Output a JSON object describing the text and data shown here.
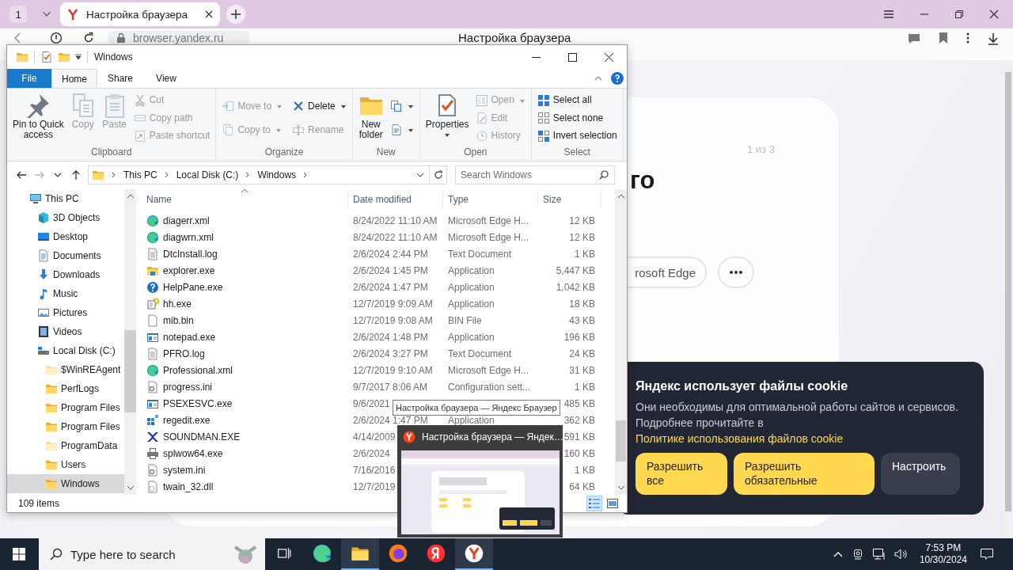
{
  "browser": {
    "tab_counter": "1",
    "tabs": [
      {
        "title": "Настройка браузера",
        "selected": true
      }
    ],
    "address": "browser.yandex.ru",
    "page_title": "Настройка браузера",
    "page": {
      "step": "1 из 3",
      "heading": "го",
      "source_button": "rosoft Edge"
    },
    "cookie_banner": {
      "title": "Яндекс использует файлы cookie",
      "text": "Они необходимы для оптимальной работы сайтов и сервисов. Подробнее прочитайте в ",
      "link": "Политике использования файлов cookie",
      "buttons": [
        {
          "label": "Разрешить все",
          "kind": "primary"
        },
        {
          "label": "Разрешить обязательные",
          "kind": "primary"
        },
        {
          "label": "Настроить",
          "kind": "secondary"
        }
      ]
    }
  },
  "explorer": {
    "title": "Windows",
    "ribbon_tabs": [
      {
        "label": "File",
        "kind": "file",
        "selected": false
      },
      {
        "label": "Home",
        "kind": "tab",
        "selected": true
      },
      {
        "label": "Share",
        "kind": "tab",
        "selected": false
      },
      {
        "label": "View",
        "kind": "tab",
        "selected": false
      }
    ],
    "ribbon_groups": [
      {
        "label": "Clipboard",
        "large": [
          {
            "label": "Pin to Quick\naccess",
            "kind": "pin",
            "disabled": false,
            "menu": false
          },
          {
            "label": "Copy",
            "kind": "copy",
            "disabled": true,
            "menu": false
          },
          {
            "label": "Paste",
            "kind": "paste",
            "disabled": true,
            "menu": false
          }
        ],
        "small": [
          {
            "label": "Cut",
            "kind": "cut",
            "disabled": true,
            "menu": false
          },
          {
            "label": "Copy path",
            "kind": "copy-path",
            "disabled": true,
            "menu": false
          },
          {
            "label": "Paste shortcut",
            "kind": "paste-shortcut",
            "disabled": true,
            "menu": false
          }
        ]
      },
      {
        "label": "Organize",
        "small": [
          {
            "label": "Move to",
            "kind": "move",
            "disabled": true,
            "menu": true
          },
          {
            "label": "Copy to",
            "kind": "copy-to",
            "disabled": true,
            "menu": true
          },
          {
            "label": "Delete",
            "kind": "delete",
            "disabled": false,
            "menu": true
          },
          {
            "label": "Rename",
            "kind": "rename",
            "disabled": true,
            "menu": false
          }
        ]
      },
      {
        "label": "New",
        "large": [
          {
            "label": "New\nfolder",
            "kind": "new-folder",
            "disabled": false,
            "menu": false
          }
        ],
        "small": [
          {
            "kind": "new-item",
            "disabled": false,
            "menu": true
          },
          {
            "kind": "easy-access",
            "disabled": false,
            "menu": true
          }
        ]
      },
      {
        "label": "Open",
        "large": [
          {
            "label": "Properties",
            "kind": "properties",
            "disabled": false,
            "menu": true
          }
        ],
        "small": [
          {
            "label": "Open",
            "kind": "open",
            "disabled": true,
            "menu": true
          },
          {
            "label": "Edit",
            "kind": "edit",
            "disabled": true,
            "menu": false
          },
          {
            "label": "History",
            "kind": "history",
            "disabled": true,
            "menu": false
          }
        ]
      },
      {
        "label": "Select",
        "small": [
          {
            "label": "Select all",
            "kind": "select-all",
            "disabled": false,
            "menu": false
          },
          {
            "label": "Select none",
            "kind": "select-none",
            "disabled": false,
            "menu": false
          },
          {
            "label": "Invert selection",
            "kind": "invert",
            "disabled": false,
            "menu": false
          }
        ]
      }
    ],
    "nav_buttons": [
      {
        "kind": "back",
        "disabled": false
      },
      {
        "kind": "forward",
        "disabled": true
      },
      {
        "kind": "recent",
        "disabled": false
      },
      {
        "kind": "up",
        "disabled": false
      }
    ],
    "breadcrumbs": [
      "This PC",
      "Local Disk (C:)",
      "Windows"
    ],
    "search": {
      "placeholder": "Search Windows"
    },
    "nav": [
      {
        "label": "This PC",
        "kind": "pc",
        "selected": false,
        "children": [
          {
            "label": "3D Objects",
            "kind": "objects3d",
            "selected": false
          },
          {
            "label": "Desktop",
            "kind": "desktop",
            "selected": false
          },
          {
            "label": "Documents",
            "kind": "documents",
            "selected": false
          },
          {
            "label": "Downloads",
            "kind": "downloads",
            "selected": false
          },
          {
            "label": "Music",
            "kind": "music",
            "selected": false
          },
          {
            "label": "Pictures",
            "kind": "pictures",
            "selected": false
          },
          {
            "label": "Videos",
            "kind": "videos",
            "selected": false
          },
          {
            "label": "Local Disk (C:)",
            "kind": "disk",
            "selected": false,
            "children": [
              {
                "label": "$WinREAgent",
                "kind": "hidden-folder",
                "selected": false
              },
              {
                "label": "PerfLogs",
                "kind": "folder",
                "selected": false
              },
              {
                "label": "Program Files",
                "kind": "folder",
                "selected": false
              },
              {
                "label": "Program Files",
                "kind": "folder",
                "selected": false
              },
              {
                "label": "ProgramData",
                "kind": "hidden-folder",
                "selected": false
              },
              {
                "label": "Users",
                "kind": "folder",
                "selected": false
              },
              {
                "label": "Windows",
                "kind": "folder",
                "selected": true
              }
            ]
          }
        ]
      }
    ],
    "columns": [
      {
        "label": "Name",
        "sorted": true
      },
      {
        "label": "Date modified",
        "sorted": false
      },
      {
        "label": "Type",
        "sorted": false
      },
      {
        "label": "Size",
        "sorted": false
      }
    ],
    "rows": [
      {
        "name": "diagerr.xml",
        "date": "8/24/2022 11:10 AM",
        "type": "Microsoft Edge H...",
        "size": "12 KB",
        "kind": "edge"
      },
      {
        "name": "diagwrn.xml",
        "date": "8/24/2022 11:10 AM",
        "type": "Microsoft Edge H...",
        "size": "12 KB",
        "kind": "edge"
      },
      {
        "name": "DtcInstall.log",
        "date": "2/6/2024 2:44 PM",
        "type": "Text Document",
        "size": "1 KB",
        "kind": "text"
      },
      {
        "name": "explorer.exe",
        "date": "2/6/2024 1:45 PM",
        "type": "Application",
        "size": "5,447 KB",
        "kind": "explorer"
      },
      {
        "name": "HelpPane.exe",
        "date": "2/6/2024 1:47 PM",
        "type": "Application",
        "size": "1,042 KB",
        "kind": "help"
      },
      {
        "name": "hh.exe",
        "date": "12/7/2019 9:09 AM",
        "type": "Application",
        "size": "18 KB",
        "kind": "hh"
      },
      {
        "name": "mib.bin",
        "date": "12/7/2019 9:08 AM",
        "type": "BIN File",
        "size": "43 KB",
        "kind": "blank"
      },
      {
        "name": "notepad.exe",
        "date": "2/6/2024 1:48 PM",
        "type": "Application",
        "size": "196 KB",
        "kind": "notepad"
      },
      {
        "name": "PFRO.log",
        "date": "2/6/2024 3:27 PM",
        "type": "Text Document",
        "size": "24 KB",
        "kind": "text"
      },
      {
        "name": "Professional.xml",
        "date": "12/7/2019 9:10 AM",
        "type": "Microsoft Edge H...",
        "size": "31 KB",
        "kind": "edge"
      },
      {
        "name": "progress.ini",
        "date": "9/7/2017 8:06 AM",
        "type": "Configuration sett...",
        "size": "1 KB",
        "kind": "ini"
      },
      {
        "name": "PSEXESVC.exe",
        "date": "9/6/2021",
        "size": "485 KB",
        "kind": "notepad"
      },
      {
        "name": "regedit.exe",
        "date": "2/6/2024 1:47 PM",
        "type": "Application",
        "size": "362 KB",
        "kind": "regedit"
      },
      {
        "name": "SOUNDMAN.EXE",
        "date": "4/14/2009",
        "size": "591 KB",
        "kind": "sound"
      },
      {
        "name": "splwow64.exe",
        "date": "2/6/2024",
        "size": "160 KB",
        "kind": "printer"
      },
      {
        "name": "system.ini",
        "date": "7/16/2016",
        "size": "1 KB",
        "kind": "ini"
      },
      {
        "name": "twain_32.dll",
        "date": "12/7/2019",
        "size": "64 KB",
        "kind": "dll"
      }
    ],
    "item_count": "109 items",
    "views": [
      {
        "kind": "details",
        "selected": true
      },
      {
        "kind": "large-icons",
        "selected": false
      }
    ]
  },
  "tooltip": "Настройка браузера — Яндекс Браузер",
  "preview": {
    "title": "Настройка браузера — Яндек…",
    "kind": "picture"
  },
  "taskbar": {
    "search": {
      "placeholder": "Type here to search"
    },
    "apps": [
      {
        "kind": "task-view",
        "active": false
      },
      {
        "kind": "edge",
        "active": false
      },
      {
        "kind": "explorer",
        "active": true
      },
      {
        "kind": "firefox",
        "active": false
      },
      {
        "kind": "yandex",
        "active": false
      },
      {
        "kind": "yandex-browser",
        "active": true
      }
    ],
    "time": "7:53 PM",
    "date": "10/30/2024"
  }
}
